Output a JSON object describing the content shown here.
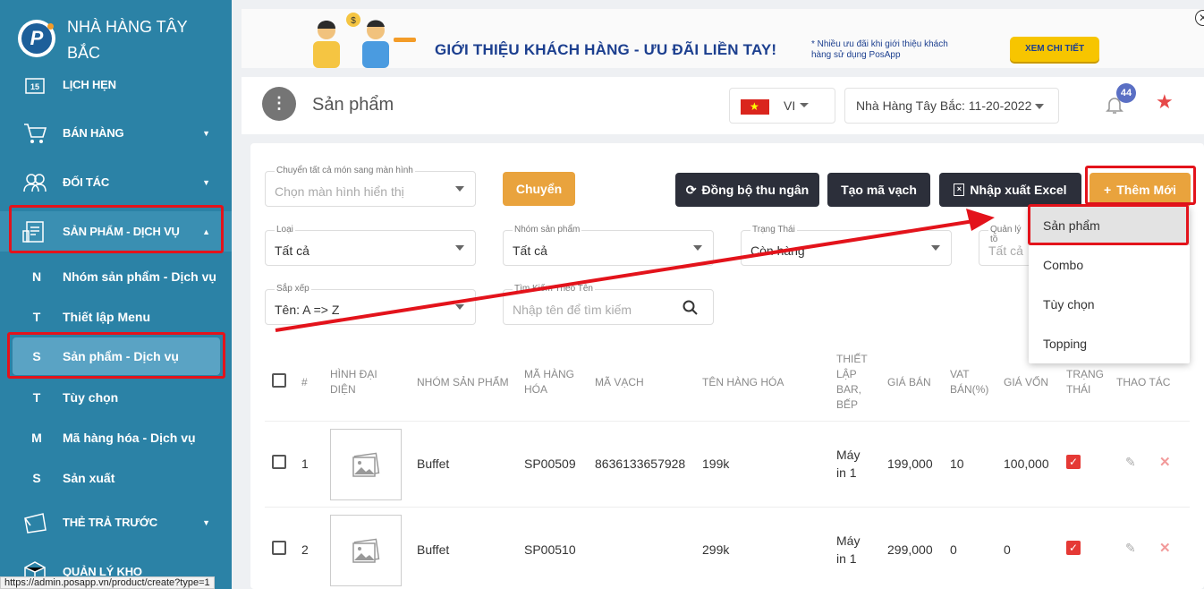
{
  "brand": {
    "name": "NHÀ HÀNG TÂY BẮC",
    "logo_letter": "P"
  },
  "sidebar": {
    "items": [
      {
        "label": "LỊCH HẸN",
        "icon": "calendar-icon",
        "num": "15"
      },
      {
        "label": "BÁN HÀNG",
        "icon": "cart-icon"
      },
      {
        "label": "ĐỐI TÁC",
        "icon": "partners-icon"
      },
      {
        "label": "SẢN PHẨM - DỊCH VỤ",
        "icon": "product-icon"
      },
      {
        "label": "THẺ TRẢ TRƯỚC",
        "icon": "prepaid-card-icon"
      },
      {
        "label": "QUẢN LÝ KHO",
        "icon": "warehouse-icon"
      }
    ],
    "sub_items": [
      {
        "letter": "N",
        "label": "Nhóm sản phẩm - Dịch vụ"
      },
      {
        "letter": "T",
        "label": "Thiết lập Menu"
      },
      {
        "letter": "S",
        "label": "Sản phẩm - Dịch vụ"
      },
      {
        "letter": "T",
        "label": "Tùy chọn"
      },
      {
        "letter": "M",
        "label": "Mã hàng hóa - Dịch vụ"
      },
      {
        "letter": "S",
        "label": "Sản xuất"
      }
    ]
  },
  "banner": {
    "headline": "GIỚI THIỆU KHÁCH HÀNG - ƯU ĐÃI LIỀN TAY!",
    "note": "* Nhiều ưu đãi khi giới thiệu khách hàng sử dụng PosApp",
    "cta": "XEM CHI TIẾT",
    "close": "✕"
  },
  "header": {
    "title": "Sản phẩm",
    "lang": "VI",
    "store": "Nhà Hàng Tây Bắc: 11-20-2022",
    "notif_count": "44"
  },
  "filters": {
    "move_label": "Chuyển tất cả món sang màn hình",
    "move_placeholder": "Chọn màn hình hiển thị",
    "type_label": "Loại",
    "type_value": "Tất cả",
    "group_label": "Nhóm sản phẩm",
    "group_value": "Tất cả",
    "status_label": "Trạng Thái",
    "status_value": "Còn hàng",
    "manage_label": "Quản lý tồ",
    "manage_value": "Tất cả",
    "sort_label": "Sắp xếp",
    "sort_value": "Tên: A => Z",
    "search_label": "Tìm Kiếm Theo Tên",
    "search_placeholder": "Nhập tên để tìm kiếm"
  },
  "buttons": {
    "move": "Chuyển",
    "sync": "Đồng bộ thu ngân",
    "barcode": "Tạo mã vạch",
    "excel": "Nhập xuất Excel",
    "add": "Thêm Mới"
  },
  "dropdown": [
    "Sản phẩm",
    "Combo",
    "Tùy chọn",
    "Topping"
  ],
  "table": {
    "headers": {
      "num": "#",
      "image": "HÌNH ĐẠI DIỆN",
      "group": "NHÓM SẢN PHẨM",
      "code": "MÃ HÀNG HÓA",
      "barcode": "MÃ VẠCH",
      "name": "TÊN HÀNG HÓA",
      "setup": "THIẾT LẬP BAR, BẾP",
      "price": "GIÁ BÁN",
      "vat": "VAT BÁN(%)",
      "cost": "GIÁ VỐN",
      "status": "TRẠNG THÁI",
      "action": "THAO TÁC"
    },
    "rows": [
      {
        "num": "1",
        "group": "Buffet",
        "code": "SP00509",
        "barcode": "8636133657928",
        "name": "199k",
        "setup": "Máy in 1",
        "price": "199,000",
        "vat": "10",
        "cost": "100,000"
      },
      {
        "num": "2",
        "group": "Buffet",
        "code": "SP00510",
        "barcode": "",
        "name": "299k",
        "setup": "Máy in 1",
        "price": "299,000",
        "vat": "0",
        "cost": "0"
      }
    ]
  },
  "status_url": "https://admin.posapp.vn/product/create?type=1",
  "colors": {
    "sidebar": "#2b82a6",
    "highlight": "#e3131b",
    "accent": "#e9a33d",
    "dark_button": "#2c2f3a"
  }
}
